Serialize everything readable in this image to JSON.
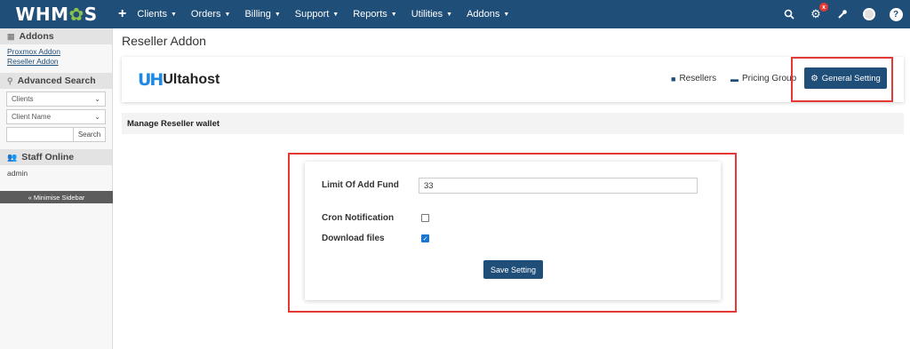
{
  "topnav": {
    "logo": "WHMCS",
    "menu": [
      {
        "label": "Clients"
      },
      {
        "label": "Orders"
      },
      {
        "label": "Billing"
      },
      {
        "label": "Support"
      },
      {
        "label": "Reports"
      },
      {
        "label": "Utilities"
      },
      {
        "label": "Addons"
      }
    ],
    "notification_badge": "x",
    "icons": [
      "search-icon",
      "cog-icon",
      "wrench-icon",
      "avatar",
      "help-icon"
    ]
  },
  "sidebar": {
    "addons_heading": "Addons",
    "addon_links": [
      "Proxmox Addon",
      "Reseller Addon"
    ],
    "search_heading": "Advanced Search",
    "search_type": "Clients",
    "search_field": "Client Name",
    "search_button": "Search",
    "staff_heading": "Staff Online",
    "staff_user": "admin",
    "minimise_label": "« Minimise Sidebar"
  },
  "main": {
    "page_title": "Reseller Addon",
    "brand": "Ultahost",
    "brand_mark": "UH",
    "tabs": [
      {
        "label": "Resellers",
        "icon": "bag-icon"
      },
      {
        "label": "Pricing Group",
        "icon": "money-icon"
      }
    ],
    "active_tab": "General Setting",
    "section_title": "Manage Reseller wallet",
    "form": {
      "limit_label": "Limit Of Add Fund",
      "limit_value": "33",
      "cron_label": "Cron Notification",
      "cron_checked": false,
      "download_label": "Download files",
      "download_checked": true,
      "save_label": "Save Setting"
    }
  },
  "colors": {
    "nav_bg": "#1f4e79",
    "accent": "#1f4e79",
    "highlight": "#e53935"
  }
}
